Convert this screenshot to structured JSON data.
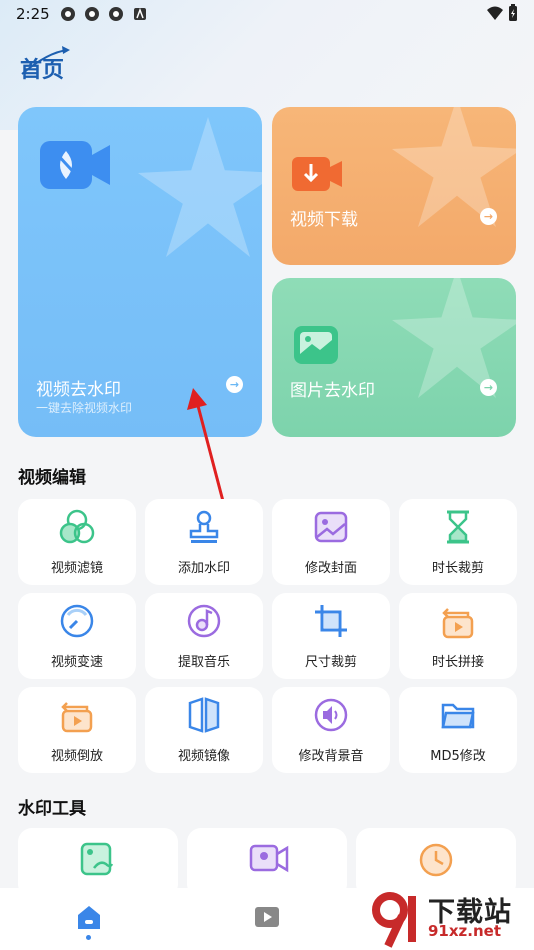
{
  "status_bar": {
    "time": "2:25"
  },
  "header": {
    "title": "首页"
  },
  "hero": {
    "remove_watermark": {
      "title": "视频去水印",
      "subtitle": "一键去除视频水印"
    },
    "video_download": {
      "title": "视频下载"
    },
    "image_remove": {
      "title": "图片去水印"
    }
  },
  "video_edit": {
    "section_title": "视频编辑",
    "tools": [
      {
        "label": "视频滤镜",
        "icon": "filter-icon"
      },
      {
        "label": "添加水印",
        "icon": "stamp-icon"
      },
      {
        "label": "修改封面",
        "icon": "image-icon"
      },
      {
        "label": "时长裁剪",
        "icon": "hourglass-icon"
      },
      {
        "label": "视频变速",
        "icon": "speedometer-icon"
      },
      {
        "label": "提取音乐",
        "icon": "music-icon"
      },
      {
        "label": "尺寸裁剪",
        "icon": "crop-icon"
      },
      {
        "label": "时长拼接",
        "icon": "join-icon"
      },
      {
        "label": "视频倒放",
        "icon": "reverse-icon"
      },
      {
        "label": "视频镜像",
        "icon": "mirror-icon"
      },
      {
        "label": "修改背景音",
        "icon": "speaker-icon"
      },
      {
        "label": "MD5修改",
        "icon": "folder-icon"
      }
    ]
  },
  "watermark_tools": {
    "section_title": "水印工具"
  },
  "watermark_brand": {
    "big": "下载站",
    "small": "91xz.net"
  },
  "colors": {
    "blue": "#7fc6fb",
    "orange": "#f3a96a",
    "green": "#7dd3ac",
    "accent": "#3a86e8"
  }
}
